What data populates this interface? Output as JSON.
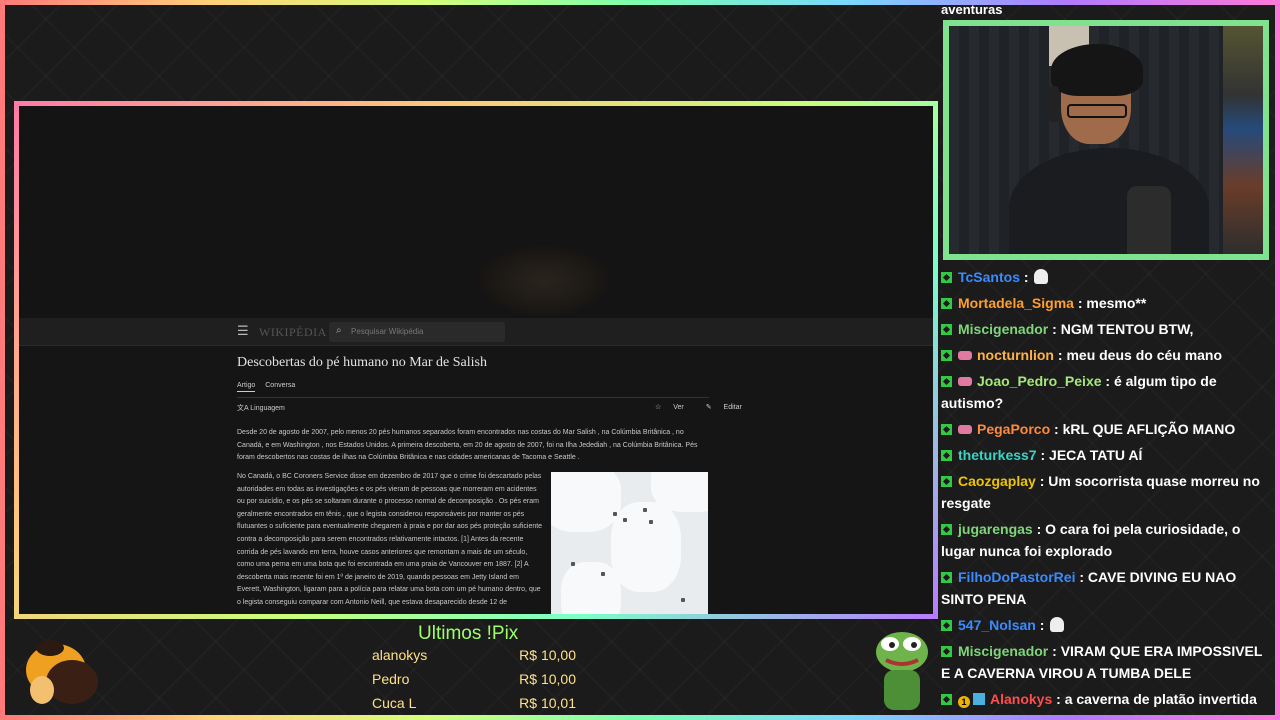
{
  "stream": {
    "top_text": "aventuras"
  },
  "wiki": {
    "search_placeholder": "Pesquisar Wikipédia",
    "logo": "WIKIPÉDIA",
    "title": "Descobertas do pé humano no Mar de Salish",
    "tabs": [
      "Artigo",
      "Conversa"
    ],
    "language_label": "Linguagem",
    "view_label": "Ver",
    "edit_label": "Editar",
    "intro": "Desde 20 de agosto de 2007, pelo menos 20 pés humanos separados foram encontrados nas costas do Mar Salish , na Colúmbia Britânica , no Canadá, e em Washington , nos Estados Unidos. A primeira descoberta, em 20 de agosto de 2007, foi na Ilha Jedediah , na Colúmbia Britânica. Pés foram descobertos nas costas de ilhas na Colúmbia Britânica e nas cidades americanas de Tacoma e Seattle .",
    "body": "No Canadá, o BC Coroners Service disse em dezembro de 2017 que o crime foi descartado pelas autoridades em todas as investigações e os pés vieram de pessoas que morreram em acidentes ou por suicídio, e os pés se soltaram durante o processo normal de decomposição . Os pés eram geralmente encontrados em tênis , que o legista considerou responsáveis por manter os pés flutuantes o suficiente para eventualmente chegarem à praia e por dar aos pés proteção suficiente contra a decomposição para serem encontrados relativamente intactos. [1] Antes da recente corrida de pés lavando em terra, houve casos anteriores que remontam a mais de um século, como uma perna em uma bota que foi encontrada em uma praia de Vancouver em 1887. [2] A descoberta mais recente foi em 1º de janeiro de 2019, quando pessoas em Jetty Island em Everett, Washington, ligaram para a polícia para relatar uma bota com um pé humano dentro, que o legista conseguiu comparar com Antonio Neill, que estava desaparecido desde 12 de"
  },
  "chat": [
    {
      "user": "TcSantos",
      "color": "#3a8bff",
      "text": "",
      "emote": "ghost",
      "badges": [
        "k"
      ]
    },
    {
      "user": "Mortadela_Sigma",
      "color": "#ff9f2e",
      "text": "mesmo**",
      "badges": [
        "k"
      ]
    },
    {
      "user": "Miscigenador",
      "color": "#7fd67a",
      "text": "NGM TENTOU BTW,",
      "badges": [
        "k"
      ]
    },
    {
      "user": "nocturnlion",
      "color": "#ffb347",
      "text": "meu deus do céu mano",
      "badges": [
        "k",
        "sub"
      ]
    },
    {
      "user": "Joao_Pedro_Peixe",
      "color": "#a5e87a",
      "text": "é algum tipo de autismo?",
      "badges": [
        "k",
        "sub"
      ]
    },
    {
      "user": "PegaPorco",
      "color": "#ff8a3d",
      "text": "kRL QUE AFLIÇÃO MANO",
      "badges": [
        "k",
        "sub"
      ]
    },
    {
      "user": "theturkess7",
      "color": "#3ad3c4",
      "text": "JECA TATU AÍ",
      "badges": [
        "k"
      ]
    },
    {
      "user": "Caozgaplay",
      "color": "#f0c400",
      "text": "Um socorrista quase morreu no resgate",
      "badges": [
        "k"
      ]
    },
    {
      "user": "jugarengas",
      "color": "#7fd67a",
      "text": "O cara foi pela curiosidade, o lugar nunca foi explorado",
      "badges": [
        "k"
      ]
    },
    {
      "user": "FilhoDoPastorRei",
      "color": "#3a8bff",
      "text": "CAVE DIVING EU NAO SINTO PENA",
      "badges": [
        "k"
      ]
    },
    {
      "user": "547_Nolsan",
      "color": "#3a8bff",
      "text": "",
      "emote": "ghost",
      "badges": [
        "k"
      ]
    },
    {
      "user": "Miscigenador",
      "color": "#7fd67a",
      "text": "VIRAM QUE ERA IMPOSSIVEL E A CAVERNA VIROU A TUMBA DELE",
      "badges": [
        "k"
      ]
    },
    {
      "user": "Alanokys",
      "color": "#ff4d4d",
      "text": "a caverna de platão invertida",
      "badges": [
        "k",
        "one",
        "gift"
      ]
    }
  ],
  "pix": {
    "title": "Ultimos !Pix",
    "rows": [
      {
        "name": "alanokys",
        "amount": "R$ 10,00"
      },
      {
        "name": "Pedro",
        "amount": "R$ 10,00"
      },
      {
        "name": "Cuca L",
        "amount": "R$ 10,01"
      }
    ]
  },
  "colors": {
    "accent_green": "#7ee28f",
    "pix_title": "#9cff6a",
    "pix_text": "#ffe089",
    "link_blue": "#6b9cd8"
  }
}
